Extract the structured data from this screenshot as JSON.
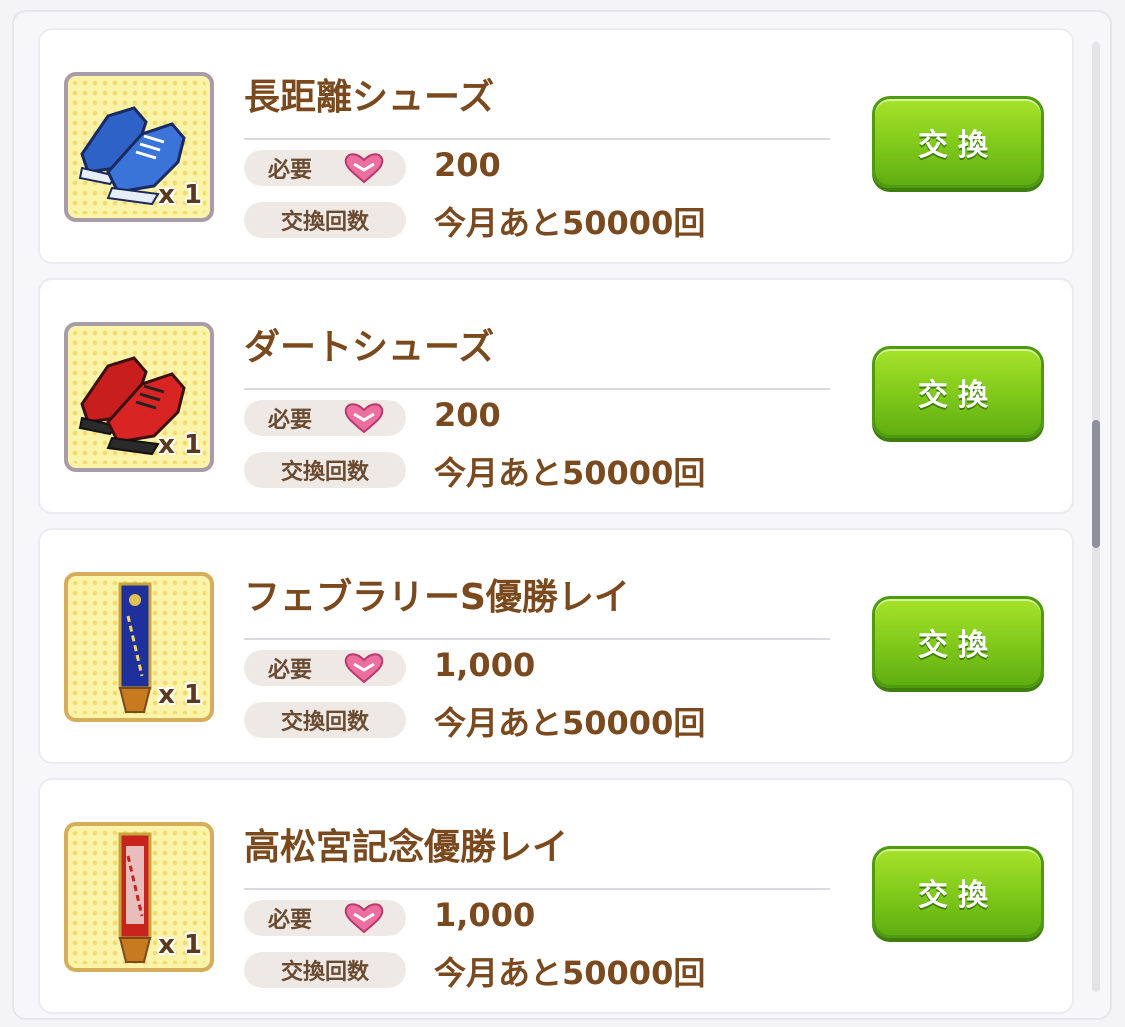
{
  "labels": {
    "need": "必要",
    "count": "交換回数",
    "exchange_button": "交換"
  },
  "items": [
    {
      "name": "長距離シューズ",
      "quantity": "x 1",
      "cost": "200",
      "remaining": "今月あと50000回",
      "icon": "blue-shoes-icon"
    },
    {
      "name": "ダートシューズ",
      "quantity": "x 1",
      "cost": "200",
      "remaining": "今月あと50000回",
      "icon": "red-shoes-icon"
    },
    {
      "name": "フェブラリーS優勝レイ",
      "quantity": "x 1",
      "cost": "1,000",
      "remaining": "今月あと50000回",
      "icon": "blue-sash-icon"
    },
    {
      "name": "高松宮記念優勝レイ",
      "quantity": "x 1",
      "cost": "1,000",
      "remaining": "今月あと50000回",
      "icon": "red-sash-icon"
    }
  ],
  "colors": {
    "button_green": "#7fc81a",
    "title_brown": "#7a4a1e",
    "heart_pink": "#ec6fa0"
  }
}
